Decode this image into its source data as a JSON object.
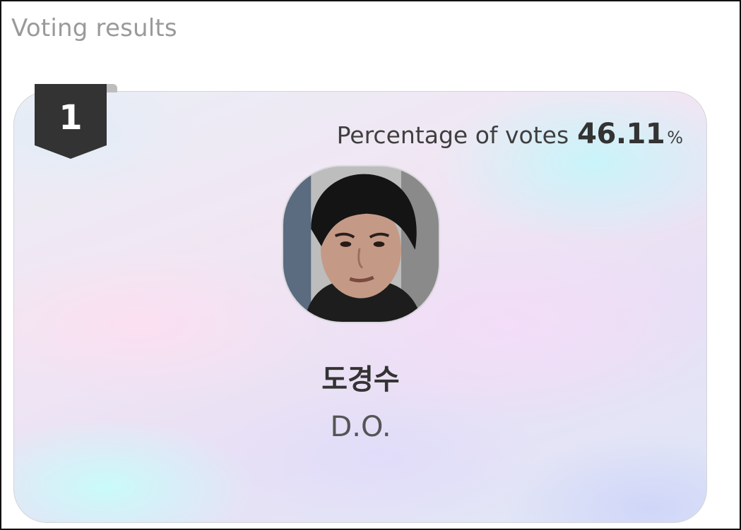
{
  "section": {
    "title": "Voting results"
  },
  "result": {
    "rank": "1",
    "votes_label": "Percentage of votes",
    "votes_percent": "46.11",
    "votes_unit": "%",
    "name_korean": "도경수",
    "name_english": "D.O."
  },
  "colors": {
    "badge": "#333333",
    "title_text": "#9a9a9a",
    "card_border": "#d4d4da"
  }
}
